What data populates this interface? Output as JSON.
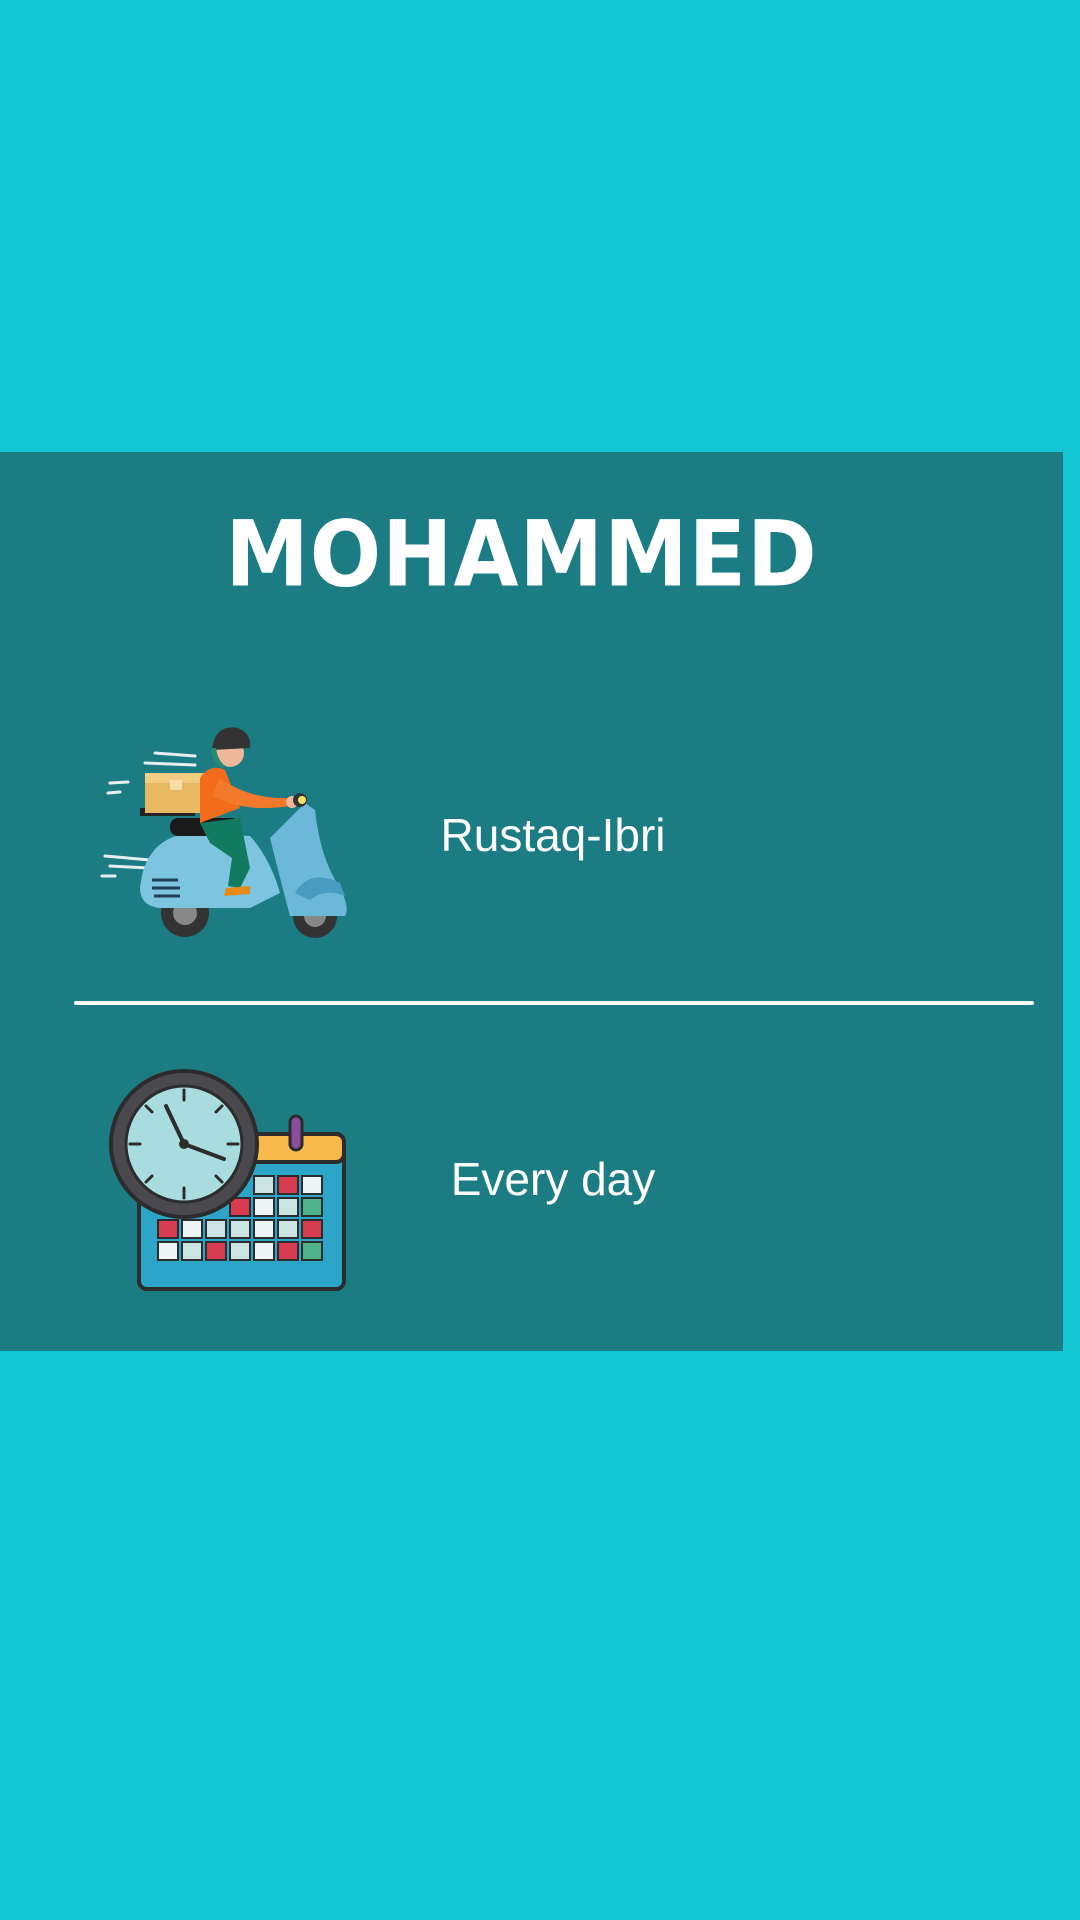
{
  "card": {
    "name": "MOHAMMED",
    "route_text": "Rustaq-Ibri",
    "schedule_text": "Every day"
  },
  "icons": {
    "route": "delivery-scooter-icon",
    "schedule": "calendar-clock-icon"
  },
  "colors": {
    "background": "#14c6d4",
    "card": "#1b7d83",
    "text": "#ffffff"
  }
}
